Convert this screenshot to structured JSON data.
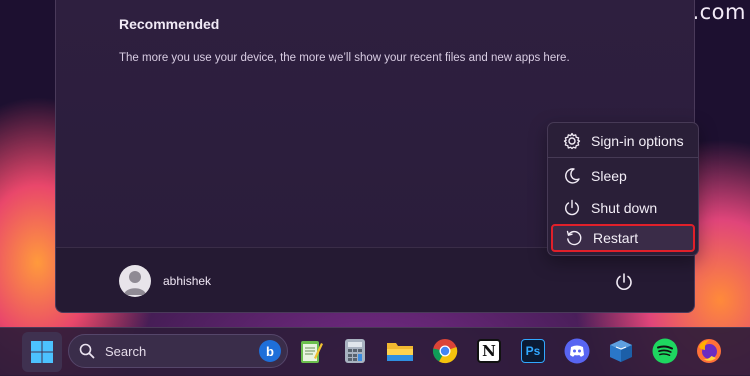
{
  "watermark": "technewstoday.com",
  "start_menu": {
    "recommended_title": "Recommended",
    "recommended_desc": "The more you use your device, the more we’ll show your recent files and new apps here.",
    "user_name": "abhishek"
  },
  "power_menu": {
    "items": [
      {
        "label": "Sign-in options",
        "icon": "gear-icon"
      },
      {
        "label": "Sleep",
        "icon": "moon-icon"
      },
      {
        "label": "Shut down",
        "icon": "power-icon"
      },
      {
        "label": "Restart",
        "icon": "restart-icon",
        "highlighted": true
      }
    ],
    "highlight_color": "#e0202a"
  },
  "taskbar": {
    "search_placeholder": "Search",
    "apps": [
      "notepad-icon",
      "calculator-icon",
      "file-explorer-icon",
      "chrome-icon",
      "notion-icon",
      "photoshop-icon",
      "discord-icon",
      "virtualbox-icon",
      "spotify-icon",
      "firefox-icon"
    ],
    "photoshop_label": "Ps",
    "notion_label": "N",
    "bing_label": "b"
  }
}
